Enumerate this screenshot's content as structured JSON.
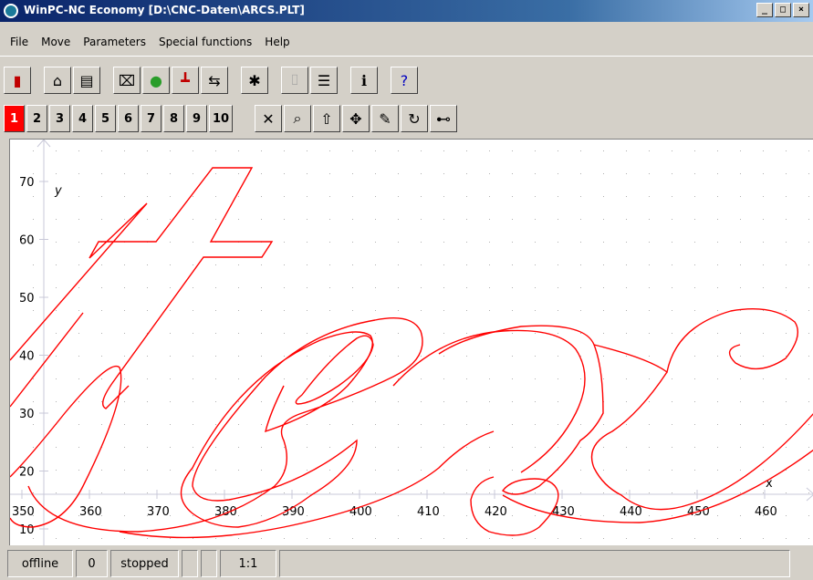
{
  "window": {
    "title": "WinPC-NC Economy [D:\\CNC-Daten\\ARCS.PLT]",
    "minimize": "_",
    "maximize": "□",
    "close": "×"
  },
  "menu": [
    "File",
    "Move",
    "Parameters",
    "Special functions",
    "Help"
  ],
  "toolbar1": [
    {
      "name": "exit-icon",
      "glyph": "▮",
      "color": "#c00000"
    },
    {
      "name": "open-folder-icon",
      "glyph": "⌂",
      "color": "#000000"
    },
    {
      "name": "document-icon",
      "glyph": "▤",
      "color": "#000000"
    },
    {
      "name": "vector-icon",
      "glyph": "⌧",
      "color": "#000000"
    },
    {
      "name": "color-layers-icon",
      "glyph": "●",
      "color": "#2a9d2a"
    },
    {
      "name": "reference-run-icon",
      "glyph": "┻",
      "color": "#c00000"
    },
    {
      "name": "teach-in-icon",
      "glyph": "⇆",
      "color": "#000000"
    },
    {
      "name": "tools-icon",
      "glyph": "✱",
      "color": "#000000"
    },
    {
      "name": "tool-change-icon",
      "glyph": "⌷",
      "color": "#9a9a9a",
      "disabled": true
    },
    {
      "name": "list-icon",
      "glyph": "☰",
      "color": "#000000"
    },
    {
      "name": "info-icon",
      "glyph": "ℹ",
      "color": "#000000"
    },
    {
      "name": "help-icon",
      "glyph": "?",
      "color": "#0000c0"
    }
  ],
  "toolbar2_numbers": [
    "1",
    "2",
    "3",
    "4",
    "5",
    "6",
    "7",
    "8",
    "9",
    "10"
  ],
  "toolbar2_tools": [
    {
      "name": "cancel-icon",
      "glyph": "✕"
    },
    {
      "name": "zoom-icon",
      "glyph": "⌕"
    },
    {
      "name": "arrow-up-icon",
      "glyph": "⇧"
    },
    {
      "name": "move-icon",
      "glyph": "✥"
    },
    {
      "name": "pen-icon",
      "glyph": "✎"
    },
    {
      "name": "redraw-icon",
      "glyph": "↻"
    },
    {
      "name": "view-icon",
      "glyph": "⊷"
    }
  ],
  "axes": {
    "x_label": "x",
    "y_label": "y",
    "x_ticks": [
      "350",
      "360",
      "370",
      "380",
      "390",
      "400",
      "410",
      "420",
      "430",
      "440",
      "450",
      "460"
    ],
    "y_ticks": [
      "10",
      "20",
      "30",
      "40",
      "50",
      "60",
      "70"
    ]
  },
  "status": [
    "offline",
    "0",
    "stopped",
    "",
    "",
    "1:1"
  ]
}
